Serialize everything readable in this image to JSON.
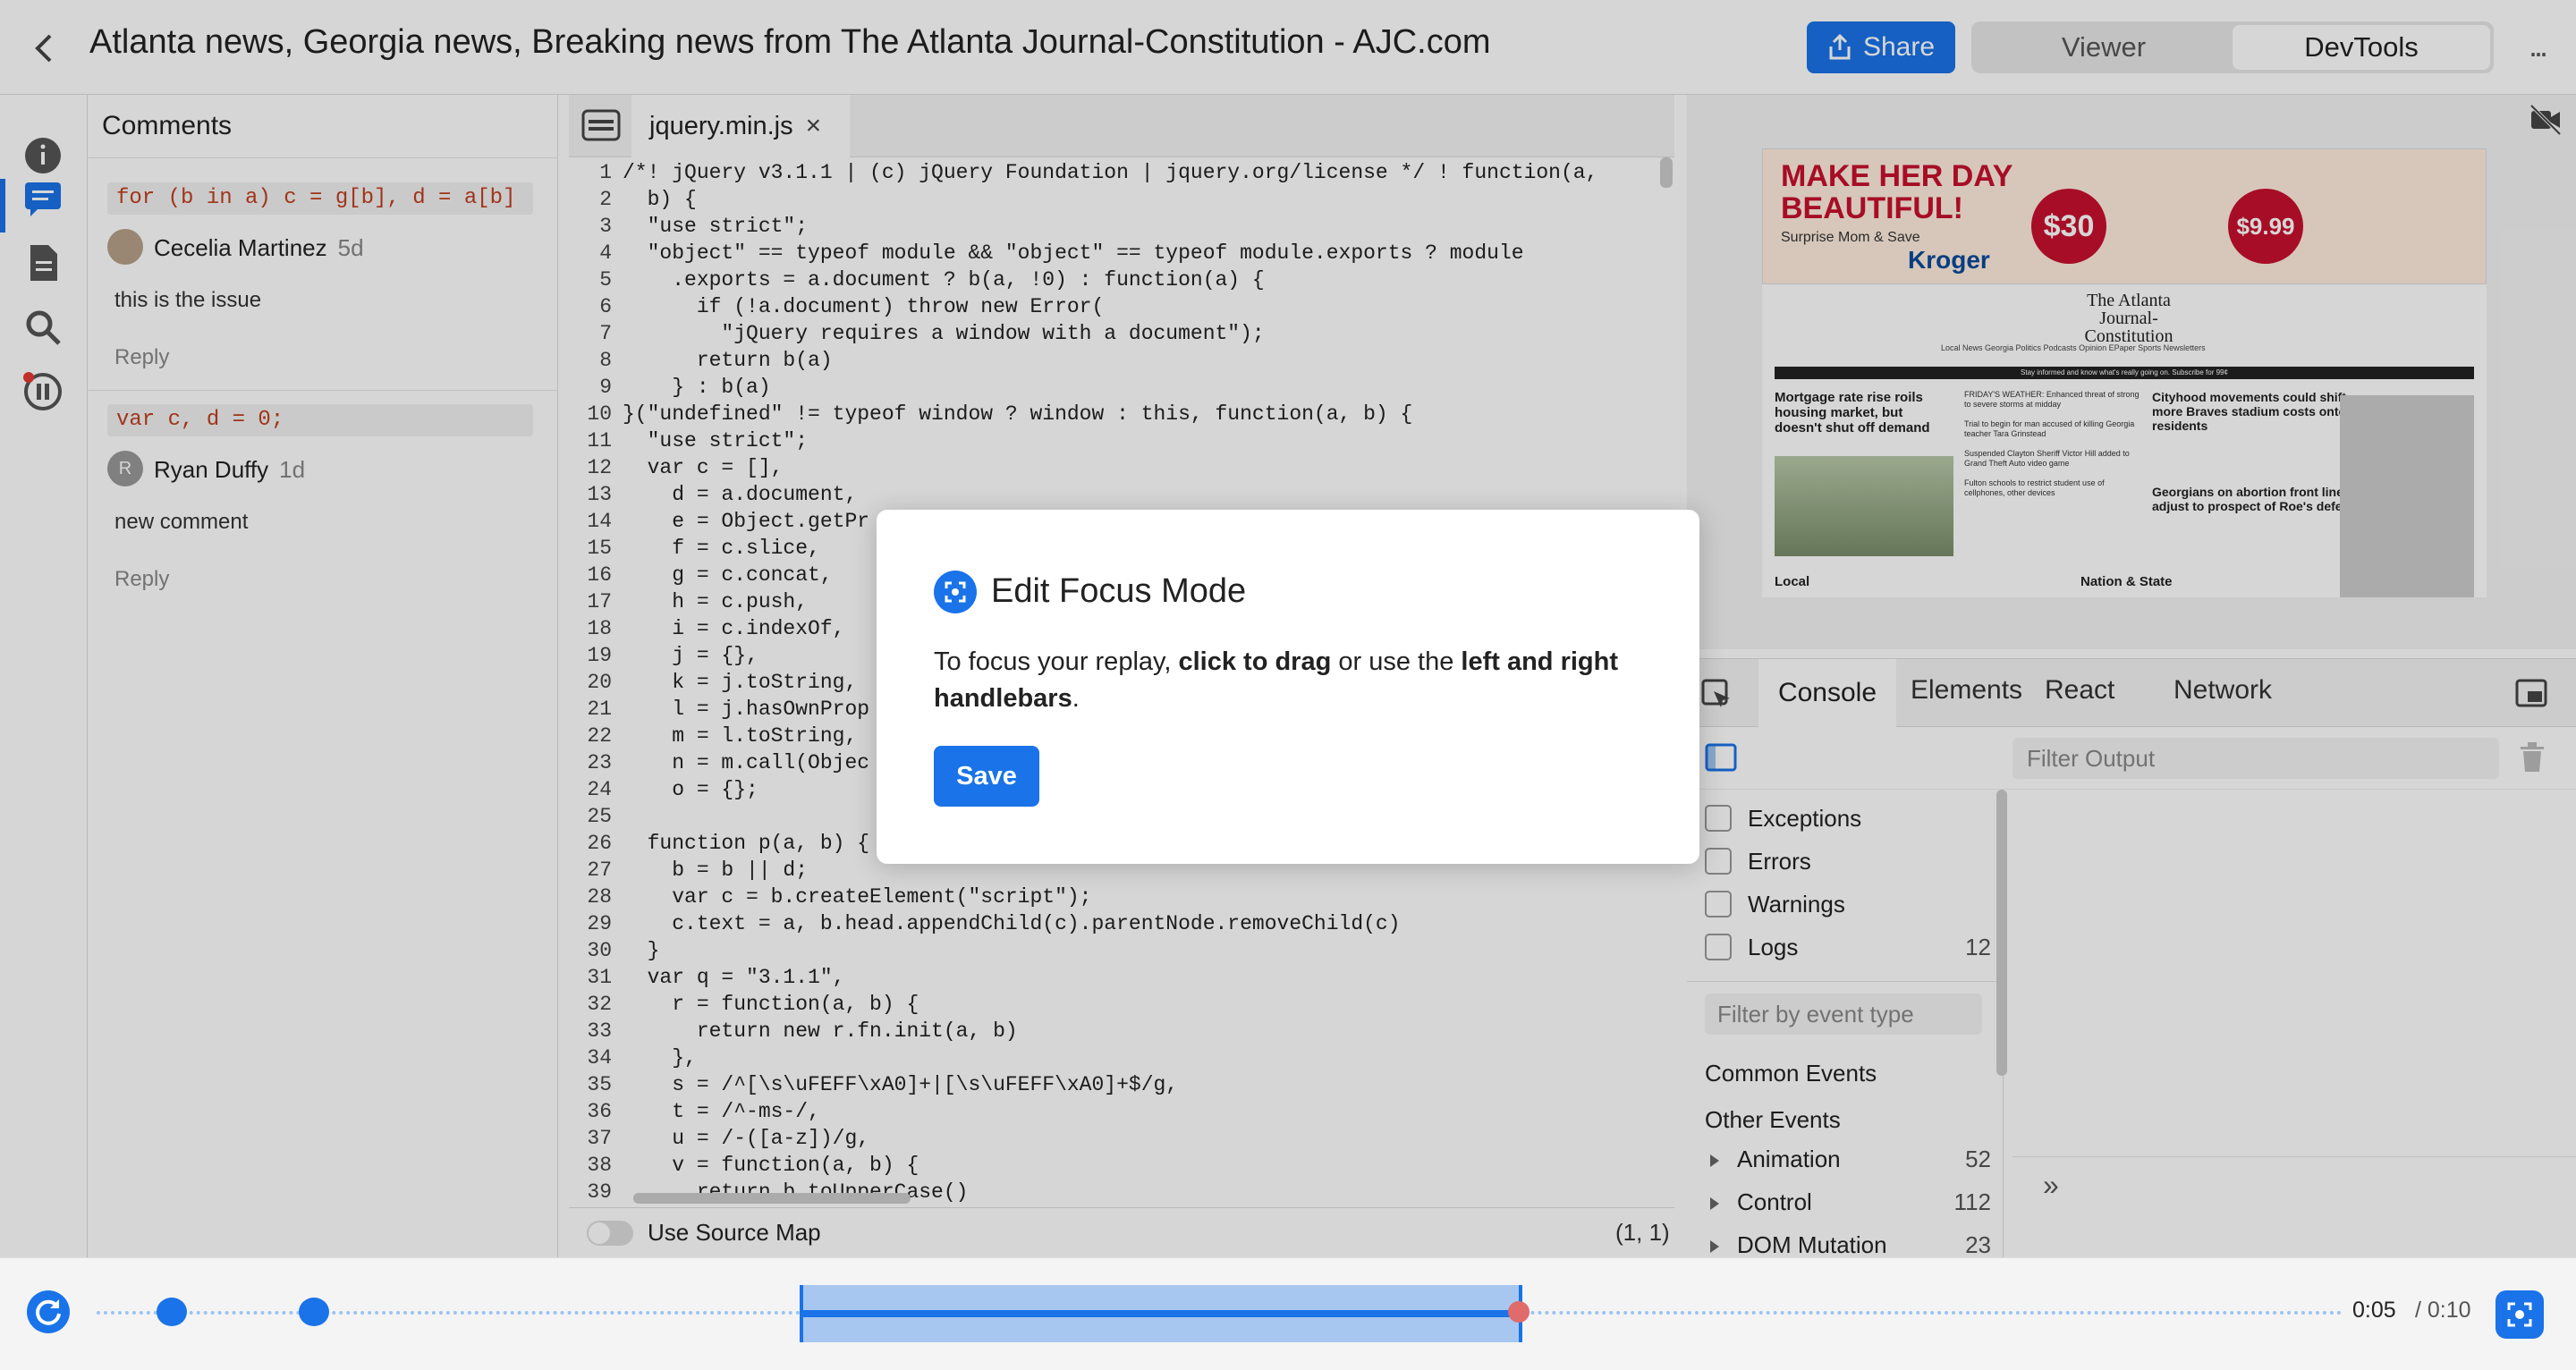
{
  "header": {
    "title": "Atlanta news, Georgia news, Breaking news from The Atlanta Journal-Constitution - AJC.com",
    "share_label": "Share",
    "viewer_label": "Viewer",
    "devtools_label": "DevTools",
    "more_label": "..."
  },
  "comments": {
    "title": "Comments",
    "items": [
      {
        "code": "for (b in a) c = g[b], d = a[b]",
        "author": "Cecelia Martinez",
        "time": "5d",
        "text": "this is the issue",
        "reply": "Reply",
        "initial": ""
      },
      {
        "code": "var c, d = 0;",
        "author": "Ryan Duffy",
        "time": "1d",
        "text": "new comment",
        "reply": "Reply",
        "initial": "R"
      }
    ]
  },
  "editor": {
    "tab_name": "jquery.min.js",
    "close_symbol": "×",
    "source_map_label": "Use Source Map",
    "cursor_position": "(1, 1)",
    "lines": [
      "/*! jQuery v3.1.1 | (c) jQuery Foundation | jquery.org/license */ ! function(a,",
      "  b) {",
      "  \"use strict\";",
      "  \"object\" == typeof module && \"object\" == typeof module.exports ? module",
      "    .exports = a.document ? b(a, !0) : function(a) {",
      "      if (!a.document) throw new Error(",
      "        \"jQuery requires a window with a document\");",
      "      return b(a)",
      "    } : b(a)",
      "}(\"undefined\" != typeof window ? window : this, function(a, b) {",
      "  \"use strict\";",
      "  var c = [],",
      "    d = a.document,",
      "    e = Object.getPr",
      "    f = c.slice,",
      "    g = c.concat,",
      "    h = c.push,",
      "    i = c.indexOf,",
      "    j = {},",
      "    k = j.toString,",
      "    l = j.hasOwnProp",
      "    m = l.toString,",
      "    n = m.call(Objec",
      "    o = {};",
      "",
      "  function p(a, b) {",
      "    b = b || d;",
      "    var c = b.createElement(\"script\");",
      "    c.text = a, b.head.appendChild(c).parentNode.removeChild(c)",
      "  }",
      "  var q = \"3.1.1\",",
      "    r = function(a, b) {",
      "      return new r.fn.init(a, b)",
      "    },",
      "    s = /^[\\s\\uFEFF\\xA0]+|[\\s\\uFEFF\\xA0]+$/g,",
      "    t = /^-ms-/,",
      "    u = /-([a-z])/g,",
      "    v = function(a, b) {",
      "      return b.toUpperCase()"
    ]
  },
  "preview": {
    "ad_headline": "MAKE HER DAY\nBEAUTIFUL!",
    "ad_sub": "Surprise Mom & Save",
    "ad_price1": "$30",
    "ad_price2": "$9.99",
    "ad_brand": "Kroger",
    "masthead": "The Atlanta Journal-Constitution",
    "nav": "Local News   Georgia Politics   Podcasts   Opinion   EPaper   Sports   Newsletters",
    "strip": "Stay informed and know what's really going on.  Subscribe for 99¢",
    "headline1": "Mortgage rate rise roils housing market, but doesn't shut off demand",
    "headline_col2": "FRIDAY'S WEATHER: Enhanced threat of strong to severe storms at midday\n\nTrial to begin for man accused of killing Georgia teacher Tara Grinstead\n\nSuspended Clayton Sheriff Victor Hill added to Grand Theft Auto video game\n\nFulton schools to restrict student use of cellphones, other devices",
    "headline3": "Cityhood movements could shift more Braves stadium costs onto residents",
    "headline4": "Georgians on abortion front line adjust to prospect of Roe's defeat",
    "section_local": "Local",
    "section_nation": "Nation & State"
  },
  "devtools": {
    "tabs": [
      "Console",
      "Elements",
      "React",
      "Network"
    ],
    "filter_output_placeholder": "Filter Output",
    "filters": [
      {
        "label": "Exceptions",
        "count": ""
      },
      {
        "label": "Errors",
        "count": ""
      },
      {
        "label": "Warnings",
        "count": ""
      },
      {
        "label": "Logs",
        "count": "12"
      }
    ],
    "filter_event_placeholder": "Filter by event type",
    "common_events": "Common Events",
    "other_events": "Other Events",
    "events": [
      {
        "label": "Animation",
        "count": "52"
      },
      {
        "label": "Control",
        "count": "112"
      },
      {
        "label": "DOM Mutation",
        "count": "23"
      }
    ],
    "prompt": "»"
  },
  "dialog": {
    "title": "Edit Focus Mode",
    "body_pre": "To focus your replay, ",
    "body_bold1": "click to drag",
    "body_mid": " or use the ",
    "body_bold2": "left and right handlebars",
    "body_post": ".",
    "save_label": "Save"
  },
  "timeline": {
    "current_time": "0:05",
    "total_time": "/ 0:10",
    "progress_fraction": 0.5
  },
  "colors": {
    "accent": "#1a73e8",
    "ad_red": "#c8102e"
  }
}
